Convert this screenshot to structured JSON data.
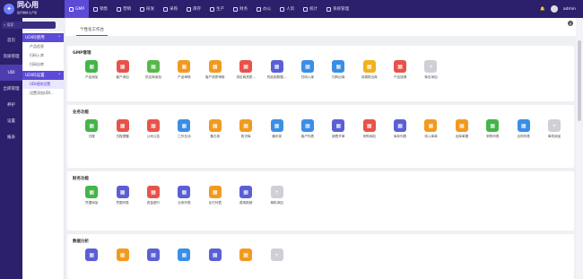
{
  "app": {
    "logo_title": "同心用",
    "logo_sub": "医疗器械·生产版",
    "logo_mark": "✦"
  },
  "topnav": [
    {
      "label": "GMP",
      "active": true
    },
    {
      "label": "销售"
    },
    {
      "label": "营销"
    },
    {
      "label": "研发"
    },
    {
      "label": "采购"
    },
    {
      "label": "库存"
    },
    {
      "label": "生产"
    },
    {
      "label": "财务"
    },
    {
      "label": "办公"
    },
    {
      "label": "人资"
    },
    {
      "label": "统计"
    },
    {
      "label": "系统管理"
    }
  ],
  "topright": {
    "bell": "🔔",
    "user": "admin"
  },
  "sidebar": {
    "search_placeholder": "搜索",
    "items": [
      {
        "label": "首页"
      },
      {
        "label": "资质管理"
      },
      {
        "label": "UDI",
        "active": true
      },
      {
        "label": "出库管理"
      },
      {
        "label": "养护"
      },
      {
        "label": "设置"
      },
      {
        "label": "报表"
      }
    ]
  },
  "subnav": {
    "group1": "UDI码使用",
    "group1_items": [
      "产品信息",
      "扫码入库",
      "扫码出库"
    ],
    "group2": "UDI码设置",
    "group2_items": [
      "UDI规则设置",
      "设置添加UDI..."
    ]
  },
  "tab": {
    "label": "个性化工作台",
    "close": "×"
  },
  "sections": [
    {
      "title": "GMP管理",
      "items": [
        {
          "label": "产品添加",
          "color": "#43b549",
          "icon": "gmp-icon"
        },
        {
          "label": "客户添加",
          "color": "#e8524a",
          "icon": "customer-icon"
        },
        {
          "label": "供应商添加",
          "color": "#56b94a",
          "icon": "supplier-icon"
        },
        {
          "label": "产品审核",
          "color": "#f29a1e",
          "icon": "product-review-icon"
        },
        {
          "label": "客户资质审核",
          "color": "#f29a1e",
          "icon": "customer-review-icon"
        },
        {
          "label": "供应商资质...",
          "color": "#e8524a",
          "icon": "supplier-review-icon"
        },
        {
          "label": "药品用数据...",
          "color": "#5b5fd6",
          "icon": "data-icon"
        },
        {
          "label": "扫码入库",
          "color": "#3a8ee6",
          "icon": "scan-in-icon"
        },
        {
          "label": "扫码出库",
          "color": "#3a8ee6",
          "icon": "scan-out-icon"
        },
        {
          "label": "待调拨出库",
          "color": "#f2b21e",
          "icon": "transfer-icon"
        },
        {
          "label": "产品追溯",
          "color": "#e8524a",
          "icon": "trace-icon"
        },
        {
          "label": "单击添加",
          "color": "#cfcfd6",
          "icon": "add-icon"
        }
      ]
    },
    {
      "title": "业务功能",
      "items": [
        {
          "label": "日程",
          "color": "#43b549",
          "icon": "schedule-icon"
        },
        {
          "label": "日程提醒",
          "color": "#e8524a",
          "icon": "reminder-icon"
        },
        {
          "label": "公司公告",
          "color": "#e8524a",
          "icon": "notice-icon"
        },
        {
          "label": "工作互动",
          "color": "#3a8ee6",
          "icon": "work-icon"
        },
        {
          "label": "备忘录",
          "color": "#f29a1e",
          "icon": "memo-icon"
        },
        {
          "label": "知识库",
          "color": "#f29a1e",
          "icon": "knowledge-icon"
        },
        {
          "label": "通讯录",
          "color": "#3a8ee6",
          "icon": "contacts-icon"
        },
        {
          "label": "客户列表",
          "color": "#3a8ee6",
          "icon": "customer-list-icon"
        },
        {
          "label": "销售开单",
          "color": "#5b5fd6",
          "icon": "sales-icon"
        },
        {
          "label": "采购添加",
          "color": "#e8524a",
          "icon": "purchase-icon"
        },
        {
          "label": "库存列表",
          "color": "#5b5fd6",
          "icon": "stock-icon"
        },
        {
          "label": "待入库单",
          "color": "#f29a1e",
          "icon": "pending-in-icon"
        },
        {
          "label": "出库单据",
          "color": "#f29a1e",
          "icon": "outbound-icon"
        },
        {
          "label": "采购列表",
          "color": "#43b549",
          "icon": "purchase-list-icon"
        },
        {
          "label": "合同列表",
          "color": "#3a8ee6",
          "icon": "contract-icon"
        },
        {
          "label": "单机添加",
          "color": "#cfcfd6",
          "icon": "add-icon"
        }
      ]
    },
    {
      "title": "财务功能",
      "items": [
        {
          "label": "凭据添加",
          "color": "#43b549",
          "icon": "voucher-icon"
        },
        {
          "label": "凭据列表",
          "color": "#5b5fd6",
          "icon": "voucher-list-icon"
        },
        {
          "label": "资金银行",
          "color": "#e8524a",
          "icon": "bank-icon"
        },
        {
          "label": "业收列表",
          "color": "#5b5fd6",
          "icon": "income-icon"
        },
        {
          "label": "业付列表",
          "color": "#f29a1e",
          "icon": "payment-icon"
        },
        {
          "label": "费用报销",
          "color": "#5b5fd6",
          "icon": "expense-icon"
        },
        {
          "label": "单机添加",
          "color": "#cfcfd6",
          "icon": "add-icon"
        }
      ]
    },
    {
      "title": "数据分析",
      "items": [
        {
          "label": "",
          "color": "#5b5fd6",
          "icon": "chart-bar-icon"
        },
        {
          "label": "",
          "color": "#f29a1e",
          "icon": "chart-column-icon"
        },
        {
          "label": "",
          "color": "#5b5fd6",
          "icon": "chart-pie-icon"
        },
        {
          "label": "",
          "color": "#3a8ee6",
          "icon": "chart-donut-icon"
        },
        {
          "label": "",
          "color": "#5b5fd6",
          "icon": "chart-line-icon"
        },
        {
          "label": "",
          "color": "#f29a1e",
          "icon": "chart-area-icon"
        },
        {
          "label": "",
          "color": "#cfcfd6",
          "icon": "add-icon"
        }
      ]
    }
  ]
}
